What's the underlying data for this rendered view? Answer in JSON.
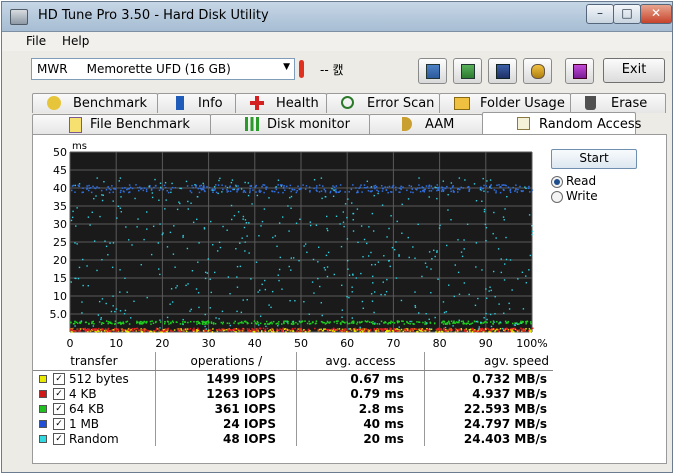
{
  "window": {
    "title": "HD Tune Pro 3.50 - Hard Disk Utility",
    "min": "–",
    "max": "□",
    "close": "✕"
  },
  "menu": [
    {
      "label": "File"
    },
    {
      "label": "Help"
    }
  ],
  "toolbar": {
    "drive": "MWR     Memorette UFD (16 GB)",
    "temperature": "-- 캜",
    "exit_label": "Exit",
    "buttons": [
      "copy-text-icon",
      "copy-screenshot-icon",
      "save-icon",
      "options-icon",
      "download-icon"
    ]
  },
  "tabs_row1": [
    {
      "label": "Benchmark",
      "icon": "benchmark-icon"
    },
    {
      "label": "Info",
      "icon": "info-icon"
    },
    {
      "label": "Health",
      "icon": "health-icon"
    },
    {
      "label": "Error Scan",
      "icon": "error-scan-icon"
    },
    {
      "label": "Folder Usage",
      "icon": "folder-usage-icon"
    },
    {
      "label": "Erase",
      "icon": "erase-icon"
    }
  ],
  "tabs_row2": [
    {
      "label": "File Benchmark",
      "icon": "file-benchmark-icon"
    },
    {
      "label": "Disk monitor",
      "icon": "disk-monitor-icon"
    },
    {
      "label": "AAM",
      "icon": "aam-icon"
    },
    {
      "label": "Random Access",
      "icon": "random-access-icon",
      "active": true
    }
  ],
  "controls": {
    "start_label": "Start",
    "read_label": "Read",
    "write_label": "Write",
    "selected": "Read"
  },
  "chart_data": {
    "type": "scatter",
    "ylabel": "ms",
    "yticks": [
      "50",
      "45",
      "40",
      "35",
      "30",
      "25",
      "20",
      "15",
      "10",
      "5.0"
    ],
    "xticks": [
      "0",
      "10",
      "20",
      "30",
      "40",
      "50",
      "60",
      "70",
      "80",
      "90",
      "100%"
    ],
    "xlim": [
      0,
      100
    ],
    "ylim": [
      0,
      50
    ],
    "grid": true,
    "background": "#1a1a1a",
    "series": [
      {
        "color": "#e8e800",
        "band_ms": 0.67
      },
      {
        "color": "#e02020",
        "band_ms": 0.79
      },
      {
        "color": "#20d020",
        "band_ms": 2.8
      },
      {
        "color": "#3070e0",
        "band_ms": 40
      },
      {
        "color": "#30d0e0",
        "band_ms": 20
      }
    ]
  },
  "table": {
    "headers": {
      "transfer": "transfer",
      "ops": "operations /",
      "access": "avg. access",
      "speed": "agv. speed"
    },
    "rows": [
      {
        "color": "#e8e800",
        "checked": "✓",
        "transfer": "512 bytes",
        "ops": "1499 IOPS",
        "access": "0.67 ms",
        "speed": "0.732 MB/s"
      },
      {
        "color": "#d01818",
        "checked": "✓",
        "transfer": "4 KB",
        "ops": "1263 IOPS",
        "access": "0.79 ms",
        "speed": "4.937 MB/s"
      },
      {
        "color": "#20c020",
        "checked": "✓",
        "transfer": "64 KB",
        "ops": "361 IOPS",
        "access": "2.8 ms",
        "speed": "22.593 MB/s"
      },
      {
        "color": "#2050d8",
        "checked": "✓",
        "transfer": "1 MB",
        "ops": "24 IOPS",
        "access": "40 ms",
        "speed": "24.797 MB/s"
      },
      {
        "color": "#30d8e0",
        "checked": "✓",
        "transfer": "Random",
        "ops": "48 IOPS",
        "access": "20 ms",
        "speed": "24.403 MB/s"
      }
    ]
  }
}
